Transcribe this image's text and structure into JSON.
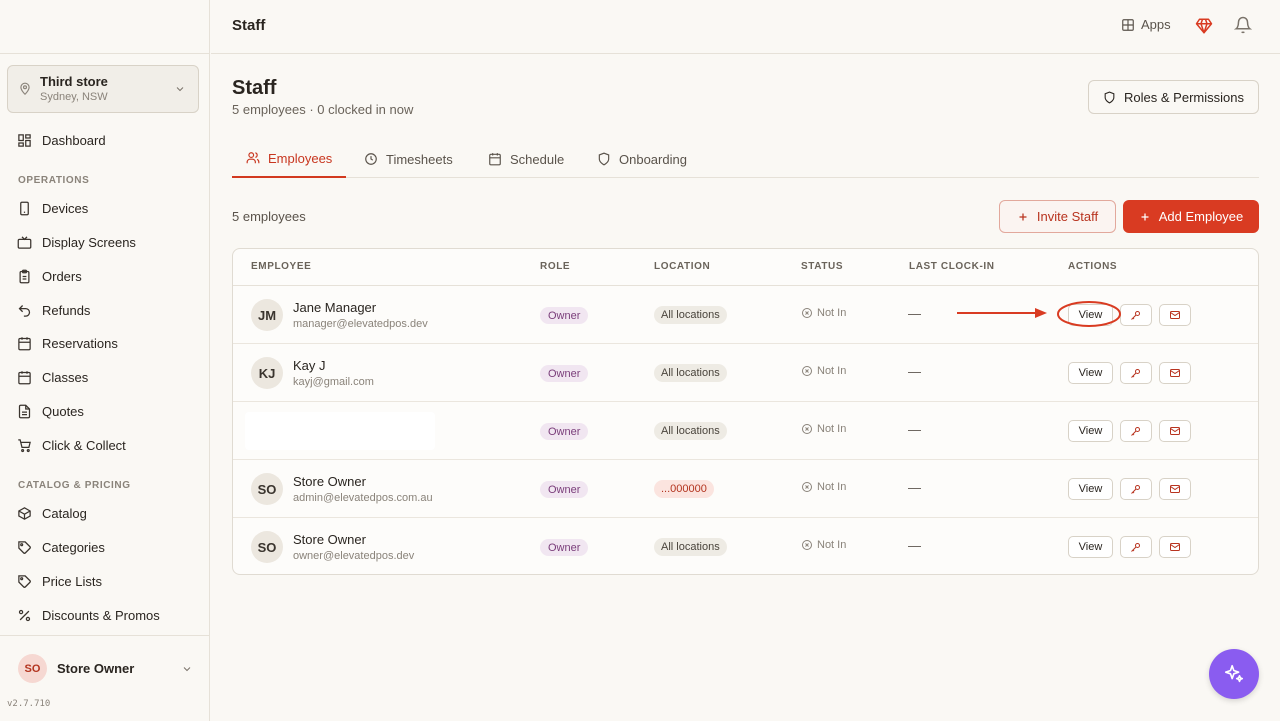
{
  "sidebar": {
    "store": {
      "name": "Third store",
      "location": "Sydney, NSW"
    },
    "items_top": [
      {
        "label": "Dashboard",
        "icon": "dashboard-icon"
      }
    ],
    "sections": [
      {
        "title": "OPERATIONS",
        "items": [
          {
            "label": "Devices",
            "icon": "device-icon"
          },
          {
            "label": "Display Screens",
            "icon": "display-icon"
          },
          {
            "label": "Orders",
            "icon": "clipboard-icon"
          },
          {
            "label": "Refunds",
            "icon": "undo-icon"
          },
          {
            "label": "Reservations",
            "icon": "calendar-icon"
          },
          {
            "label": "Classes",
            "icon": "calendar-icon"
          },
          {
            "label": "Quotes",
            "icon": "document-icon"
          },
          {
            "label": "Click & Collect",
            "icon": "cart-icon"
          }
        ]
      },
      {
        "title": "CATALOG & PRICING",
        "items": [
          {
            "label": "Catalog",
            "icon": "box-icon"
          },
          {
            "label": "Categories",
            "icon": "tag-icon"
          },
          {
            "label": "Price Lists",
            "icon": "tag-icon"
          },
          {
            "label": "Discounts & Promos",
            "icon": "percent-icon"
          }
        ]
      }
    ],
    "user": {
      "initials": "SO",
      "name": "Store Owner"
    },
    "version": "v2.7.710"
  },
  "topbar": {
    "title": "Staff",
    "apps_label": "Apps"
  },
  "header": {
    "title": "Staff",
    "subtitle": "5 employees · 0 clocked in now",
    "roles_button": "Roles & Permissions"
  },
  "tabs": [
    {
      "label": "Employees",
      "active": true
    },
    {
      "label": "Timesheets",
      "active": false
    },
    {
      "label": "Schedule",
      "active": false
    },
    {
      "label": "Onboarding",
      "active": false
    }
  ],
  "toolbar": {
    "count_label": "5 employees",
    "invite_label": "Invite Staff",
    "add_label": "Add Employee"
  },
  "table": {
    "columns": [
      "EMPLOYEE",
      "ROLE",
      "LOCATION",
      "STATUS",
      "LAST CLOCK-IN",
      "ACTIONS"
    ],
    "view_label": "View",
    "rows": [
      {
        "initials": "JM",
        "name": "Jane Manager",
        "email": "manager@elevatedpos.dev",
        "role": "Owner",
        "location": "All locations",
        "status": "Not In",
        "last_clock_in": "—"
      },
      {
        "initials": "KJ",
        "name": "Kay J",
        "email": "kayj@gmail.com",
        "role": "Owner",
        "location": "All locations",
        "status": "Not In",
        "last_clock_in": "—"
      },
      {
        "initials": "",
        "name": "",
        "email": "",
        "role": "Owner",
        "location": "All locations",
        "status": "Not In",
        "last_clock_in": "—"
      },
      {
        "initials": "SO",
        "name": "Store Owner",
        "email": "admin@elevatedpos.com.au",
        "role": "Owner",
        "location": "...000000",
        "status": "Not In",
        "last_clock_in": "—"
      },
      {
        "initials": "SO",
        "name": "Store Owner",
        "email": "owner@elevatedpos.dev",
        "role": "Owner",
        "location": "All locations",
        "status": "Not In",
        "last_clock_in": "—"
      }
    ]
  },
  "colors": {
    "accent": "#d93b22",
    "assistant": "#8a5cf0"
  }
}
